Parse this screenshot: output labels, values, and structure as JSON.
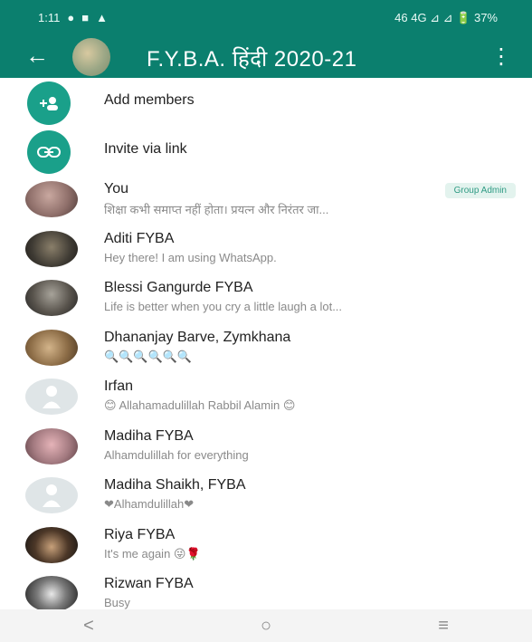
{
  "status_bar": {
    "time": "1:11",
    "right_text": "46 4G ⊿ ⊿ 🔋 37%"
  },
  "header": {
    "title": "F.Y.B.A. हिंदी 2020-21"
  },
  "actions": [
    {
      "label": "Add members"
    },
    {
      "label": "Invite via link"
    }
  ],
  "members": [
    {
      "name": "You",
      "about": "शिक्षा कभी समाप्त नहीं होता। प्रयत्न और निरंतर जा...",
      "badge": "Group Admin"
    },
    {
      "name": "Aditi FYBA",
      "about": "Hey there! I am using WhatsApp."
    },
    {
      "name": "Blessi Gangurde FYBA",
      "about": "Life is better when you cry a little laugh a lot..."
    },
    {
      "name": "Dhananjay Barve, Zymkhana",
      "about": "🔍🔍🔍🔍🔍🔍"
    },
    {
      "name": "Irfan",
      "about": "😊 Allahamadulillah Rabbil Alamin 😊"
    },
    {
      "name": "Madiha FYBA",
      "about": "Alhamdulillah for everything"
    },
    {
      "name": "Madiha Shaikh, FYBA",
      "about": "❤Alhamdulillah❤"
    },
    {
      "name": "Riya FYBA",
      "about": "It's me again 😜🌹"
    },
    {
      "name": "Rizwan FYBA",
      "about": "Busy"
    }
  ],
  "nav": {
    "back": "<",
    "home": "○",
    "recents": "≡"
  }
}
